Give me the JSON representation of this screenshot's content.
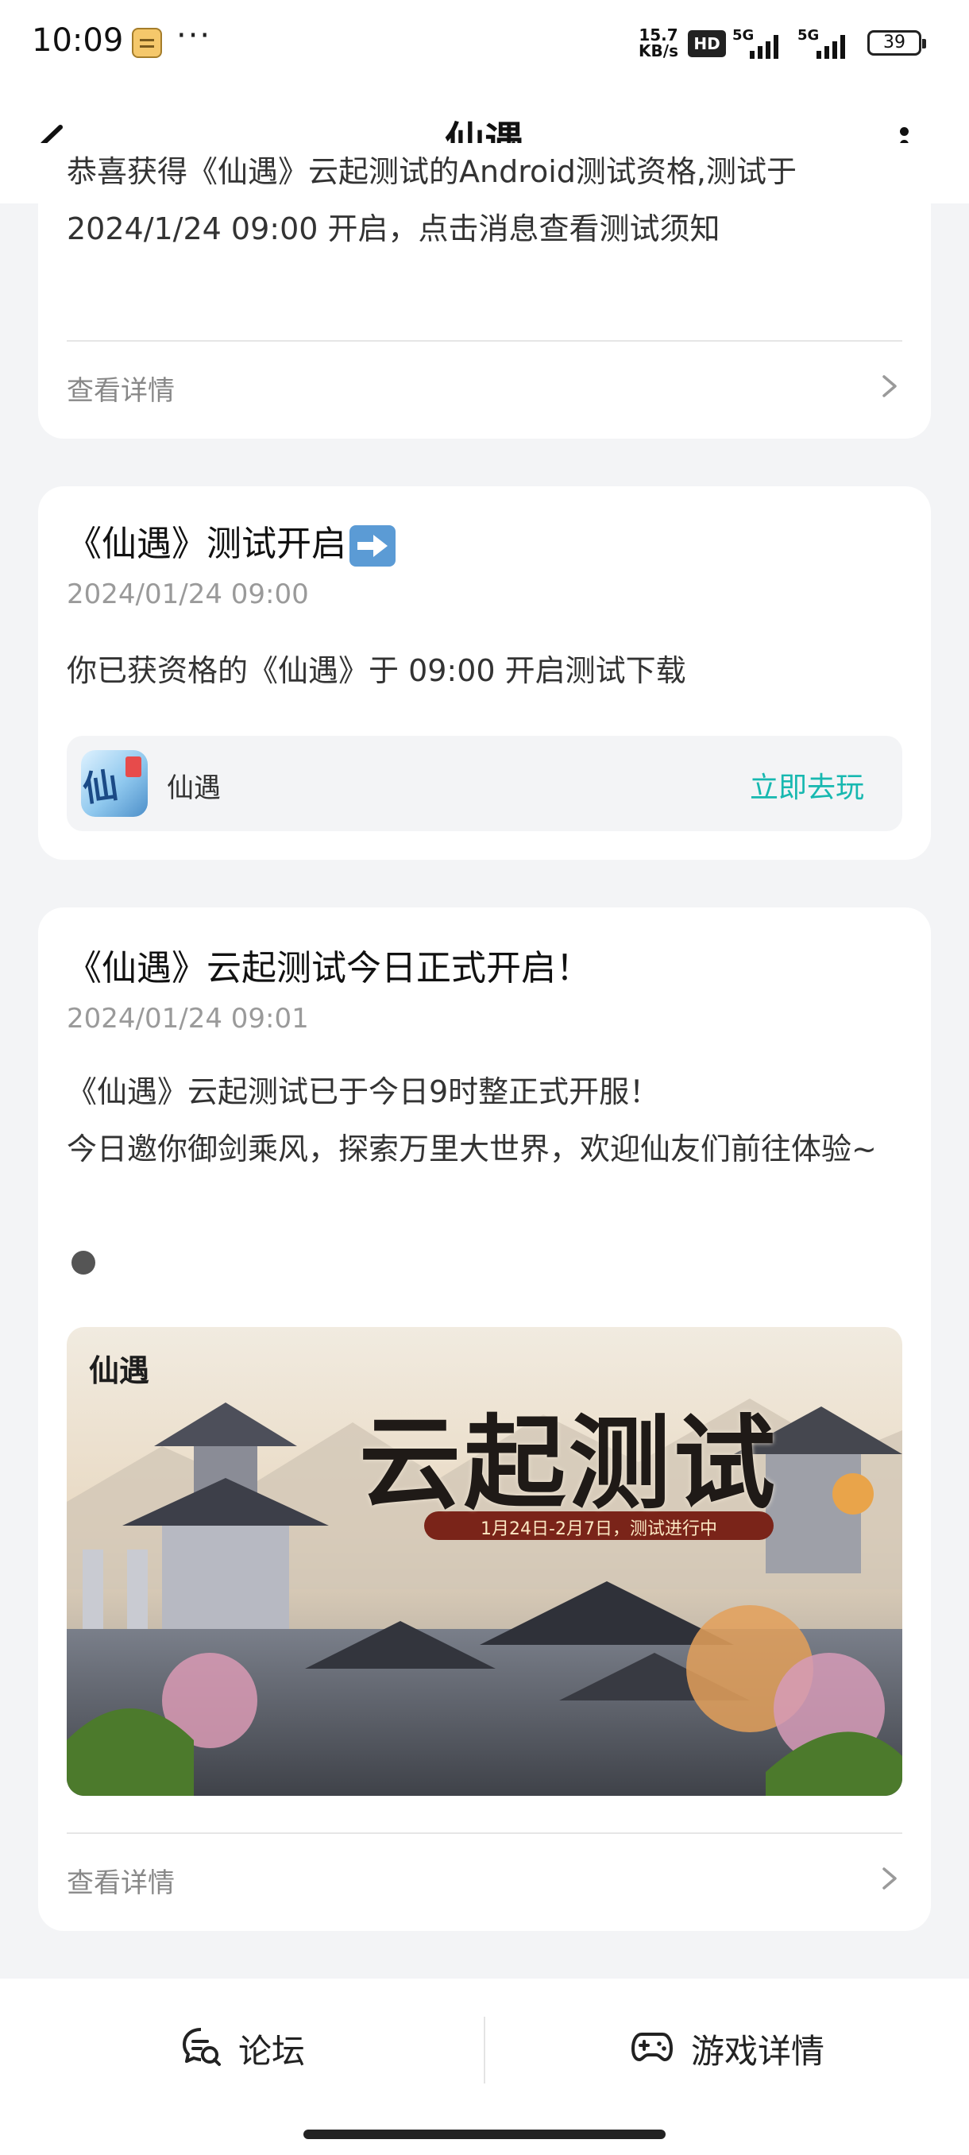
{
  "status_bar": {
    "time": "10:09",
    "more": "···",
    "net_speed_value": "15.7",
    "net_speed_unit": "KB/s",
    "hd_label": "HD",
    "sim1_label": "5G",
    "sim2_label": "5G",
    "battery": "39"
  },
  "header": {
    "title": "仙遇"
  },
  "messages": [
    {
      "body": "恭喜获得《仙遇》云起测试的Android测试资格,测试于2024/1/24 09:00 开启，点击消息查看测试须知",
      "detail_label": "查看详情"
    },
    {
      "title": "《仙遇》测试开启",
      "title_emoji": "right-arrow-emoji-icon",
      "date": "2024/01/24 09:00",
      "body": "你已获资格的《仙遇》于 09:00 开启测试下载",
      "game": {
        "icon_text": "仙遇",
        "name": "仙遇",
        "action": "立即去玩"
      }
    },
    {
      "title": "《仙遇》云起测试今日正式开启！",
      "date": "2024/01/24 09:01",
      "body_line1": "《仙遇》云起测试已于今日9时整正式开服！",
      "body_line2": "今日邀你御剑乘风，探索万里大世界，欢迎仙友们前往体验~",
      "banner": {
        "logo": "仙遇",
        "headline": "云起测试",
        "subtitle": "1月24日-2月7日，测试进行中"
      },
      "detail_label": "查看详情"
    }
  ],
  "bottom_bar": {
    "forum_label": "论坛",
    "game_detail_label": "游戏详情"
  },
  "colors": {
    "accent": "#17b8b0",
    "background": "#f3f4f6",
    "card": "#ffffff"
  }
}
